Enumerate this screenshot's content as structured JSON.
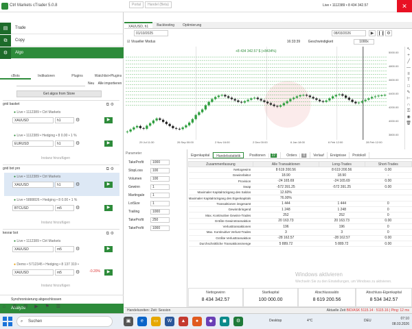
{
  "titlebar": {
    "title": "Ctrl Markets cTrader 5.0.8",
    "top_buttons": [
      "Portal",
      "Handel (Beta)"
    ],
    "account_status": "Live • 1112389 • 8 434 342.57"
  },
  "leftnav": {
    "items": [
      {
        "label": "Trade",
        "icon": "chart-icon"
      },
      {
        "label": "Copy",
        "icon": "copy-icon"
      },
      {
        "label": "Algo",
        "icon": "robot-icon"
      }
    ]
  },
  "algo": {
    "tabs": [
      "cBots",
      "Indikatoren",
      "Plugins",
      "Watchlist+Plugins"
    ],
    "new_label": "Neu",
    "import_label": "Alle importieren",
    "store_button": "Get algos from Store"
  },
  "groups": [
    {
      "name": "grid basket",
      "bots": [
        {
          "account": "Live • 1112389 • Ctrl Markets",
          "symbol": "XAUUSD",
          "timeframe": "h1",
          "pct": ""
        },
        {
          "account": "Live • 1112389 • Hedging • 8 0.00 • 1 %",
          "symbol": "EURUSD",
          "timeframe": "h1",
          "pct": ""
        }
      ],
      "add_label": "Instanz hinzufügen"
    },
    {
      "name": "grid bot pro",
      "bots": [
        {
          "account": "Live • 1112389 • Ctrl Markets",
          "symbol": "XAUUSD",
          "timeframe": "h1",
          "pct": ""
        },
        {
          "account": "Live • 5888826 • Hedging • 8 0.00 • 1 %",
          "symbol": "BTCUSD",
          "timeframe": "m5",
          "pct": ""
        }
      ],
      "add_label": "Instanz hinzufügen"
    },
    {
      "name": "kesrar bot",
      "bots": [
        {
          "account": "Live • 1112389 • Ctrl Markets",
          "symbol": "XAUUSD",
          "timeframe": "m5",
          "pct": ""
        },
        {
          "account": "Demo • 5712345 • Hedging • 8 137 319 •",
          "symbol": "XAUUSD",
          "timeframe": "m5",
          "pct": "-0.20%"
        }
      ],
      "add_label": "Instanz hinzufügen"
    }
  ],
  "sync_label": "Synchronisierung abgeschlossen",
  "analyze_label": "Analyze",
  "chart": {
    "tabs": [
      "XAUUSD, h1",
      "Backtesting",
      "Optimierung"
    ],
    "from_date": "01/10/2025",
    "to_date": "08/03/2026",
    "visual_mode": "Visueller Modus",
    "clock": "16:33:39",
    "speed_label": "Geschwindigkeit",
    "speed_value": "1000x",
    "overlay_text": "+8 434 342.57 $ (+8434%)",
    "price_labels": [
      "5000.00",
      "4800.00",
      "4600.00",
      "4400.00",
      "4200.00",
      "4000.00",
      "3800.00"
    ],
    "time_labels": [
      "29 Jul 11:30",
      "26 Sep 00:00",
      "2 Nov 16:00",
      "2 Dez 00:00",
      "6 Jan 18:00",
      "6 Feb 12:00",
      "28 Feb 12:00"
    ],
    "closes": [
      3820,
      3850,
      3880,
      3900,
      3870,
      3860,
      3905,
      3940,
      3980,
      4010,
      3990,
      3960,
      3930,
      3900,
      3870,
      3860,
      3855,
      3880,
      3910,
      3950,
      4000,
      4060,
      4100,
      4140,
      4200,
      4250,
      4290,
      4320,
      4340,
      4350,
      4330,
      4310,
      4290,
      4270,
      4250,
      4240,
      4260,
      4280,
      4300,
      4310,
      4290,
      4270,
      4250,
      4230,
      4210,
      4190,
      4180,
      4200,
      4230,
      4260,
      4290,
      4310,
      4330,
      4345,
      4350,
      4340,
      4320,
      4300,
      4280,
      4260,
      4250,
      4270,
      4300,
      4330,
      4350,
      4360,
      4340,
      4310,
      4280,
      4250,
      4230,
      4240,
      4260,
      4280,
      4300,
      4320,
      4330,
      4340,
      4345,
      4350
    ],
    "grid_levels": [
      4900,
      4850,
      4800,
      4750,
      4700,
      4650,
      4600,
      4550,
      4500,
      4450,
      4400,
      4350,
      4300,
      4250,
      4200
    ]
  },
  "params": {
    "header": "Parameter",
    "rows": [
      {
        "label": "TakeProfit",
        "value": "1000"
      },
      {
        "label": "StopLoss",
        "value": "100"
      },
      {
        "label": "Volumen",
        "value": "100"
      },
      {
        "label": "Gewinn",
        "value": "1"
      },
      {
        "label": "Martingale",
        "value": "1"
      },
      {
        "label": "LotSize",
        "value": "1"
      },
      {
        "label": "Trailing",
        "value": "1000"
      },
      {
        "label": "TakeProfit",
        "value": "250"
      },
      {
        "label": "TakeProfit",
        "value": "1000"
      }
    ]
  },
  "stats": {
    "tabs": [
      "Eigenkapital",
      "Handelsstatistik",
      "Positionen",
      "Orders",
      "Verlauf",
      "Ereignisse",
      "Protokoll"
    ],
    "positions_count": "22",
    "orders_count": "0",
    "columns": [
      "Zusammenfassung",
      "Alle Transaktionen",
      "Long-Trades",
      "Short-Trades"
    ],
    "rows": [
      [
        "Nettogewinn",
        "8 619 200.56",
        "8 619 200.56",
        "0.00"
      ],
      [
        "Gewinnfaktor",
        "18.90",
        "18.90",
        "-"
      ],
      [
        "Provision",
        "-24 165.69",
        "-24 165.69",
        "0.00"
      ],
      [
        "Swap",
        "-572 391.25",
        "-572 391.25",
        "0.00"
      ],
      [
        "Maximaler Kapitalrückgang des Saldos",
        "12.60%",
        "",
        ""
      ],
      [
        "Maximaler Kapitalrückgang des Eigenkapitals",
        "76.00%",
        "",
        ""
      ],
      [
        "Transaktionen insgesamt",
        "1 444",
        "1 444",
        "0"
      ],
      [
        "Gewinnbringend",
        "1 248",
        "1 248",
        "0"
      ],
      [
        "Max. Kontinuitive Gewinn-Trades",
        "252",
        "252",
        "0"
      ],
      [
        "Größte Gewinntransaktion",
        "20 163.73",
        "20 163.73",
        "0.00"
      ],
      [
        "Verlusttransaktionen",
        "196",
        "196",
        "0"
      ],
      [
        "Max. Kontinuitive Verlust-Trades",
        "3",
        "3",
        "0"
      ],
      [
        "Größte Verlusttransaktion",
        "-28 162.57",
        "-28 162.57",
        "0.00"
      ],
      [
        "Durchschnittliche Transaktionsmenge",
        "5 889.72",
        "5 889.72",
        "0.00"
      ]
    ],
    "summary": [
      {
        "label": "Nettogewinn",
        "value": "8 434 342.57"
      },
      {
        "label": "Startkapital",
        "value": "100 000.00"
      },
      {
        "label": "Abschlusssaldo",
        "value": "8 619 200.56"
      },
      {
        "label": "Abschluss-Eigenkapital",
        "value": "8 534 342.57"
      }
    ],
    "watermark": "Windows aktivieren",
    "watermark_sub": "Wechseln Sie zu den Einstellungen, um Windows zu aktivieren."
  },
  "statusbar": {
    "left": "Handelszeiten: Zeit: Session",
    "right": "Aktuelle Zeit",
    "right_detail": "BID/ASK 5115.14 · 5115.16 | Ping: 12 ms"
  },
  "taskbar": {
    "search_placeholder": "Suchen",
    "weather_label": "Desktop",
    "temp": "4°C",
    "lang": "DEU",
    "time": "07:10",
    "date": "08.03.2026"
  },
  "colors": {
    "accent": "#2d8b3a",
    "bull_candle": "#2e9e3e",
    "bear_candle": "#222222",
    "grid_line": "#3aa646",
    "loss": "#dd3333"
  }
}
